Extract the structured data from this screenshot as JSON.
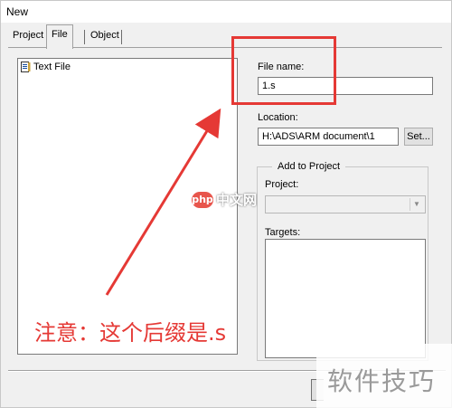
{
  "window": {
    "title": "New"
  },
  "tabs": [
    {
      "label": "Project"
    },
    {
      "label": "File"
    },
    {
      "label": "Object"
    }
  ],
  "file_list": {
    "items": [
      {
        "label": "Text File",
        "icon": "text-file-icon"
      }
    ]
  },
  "form": {
    "file_name_label": "File name:",
    "file_name_value": "1.s",
    "location_label": "Location:",
    "location_value": "H:\\ADS\\ARM document\\1",
    "set_button": "Set...",
    "add_to_project_title": "Add to Project",
    "project_label": "Project:",
    "project_value": "",
    "targets_label": "Targets:"
  },
  "annotation": {
    "note": "注意：这个后缀是.s",
    "color": "#e53935"
  },
  "watermarks": {
    "logo_text": "php",
    "site_text": "中文网",
    "corner_text": "软件技巧"
  }
}
